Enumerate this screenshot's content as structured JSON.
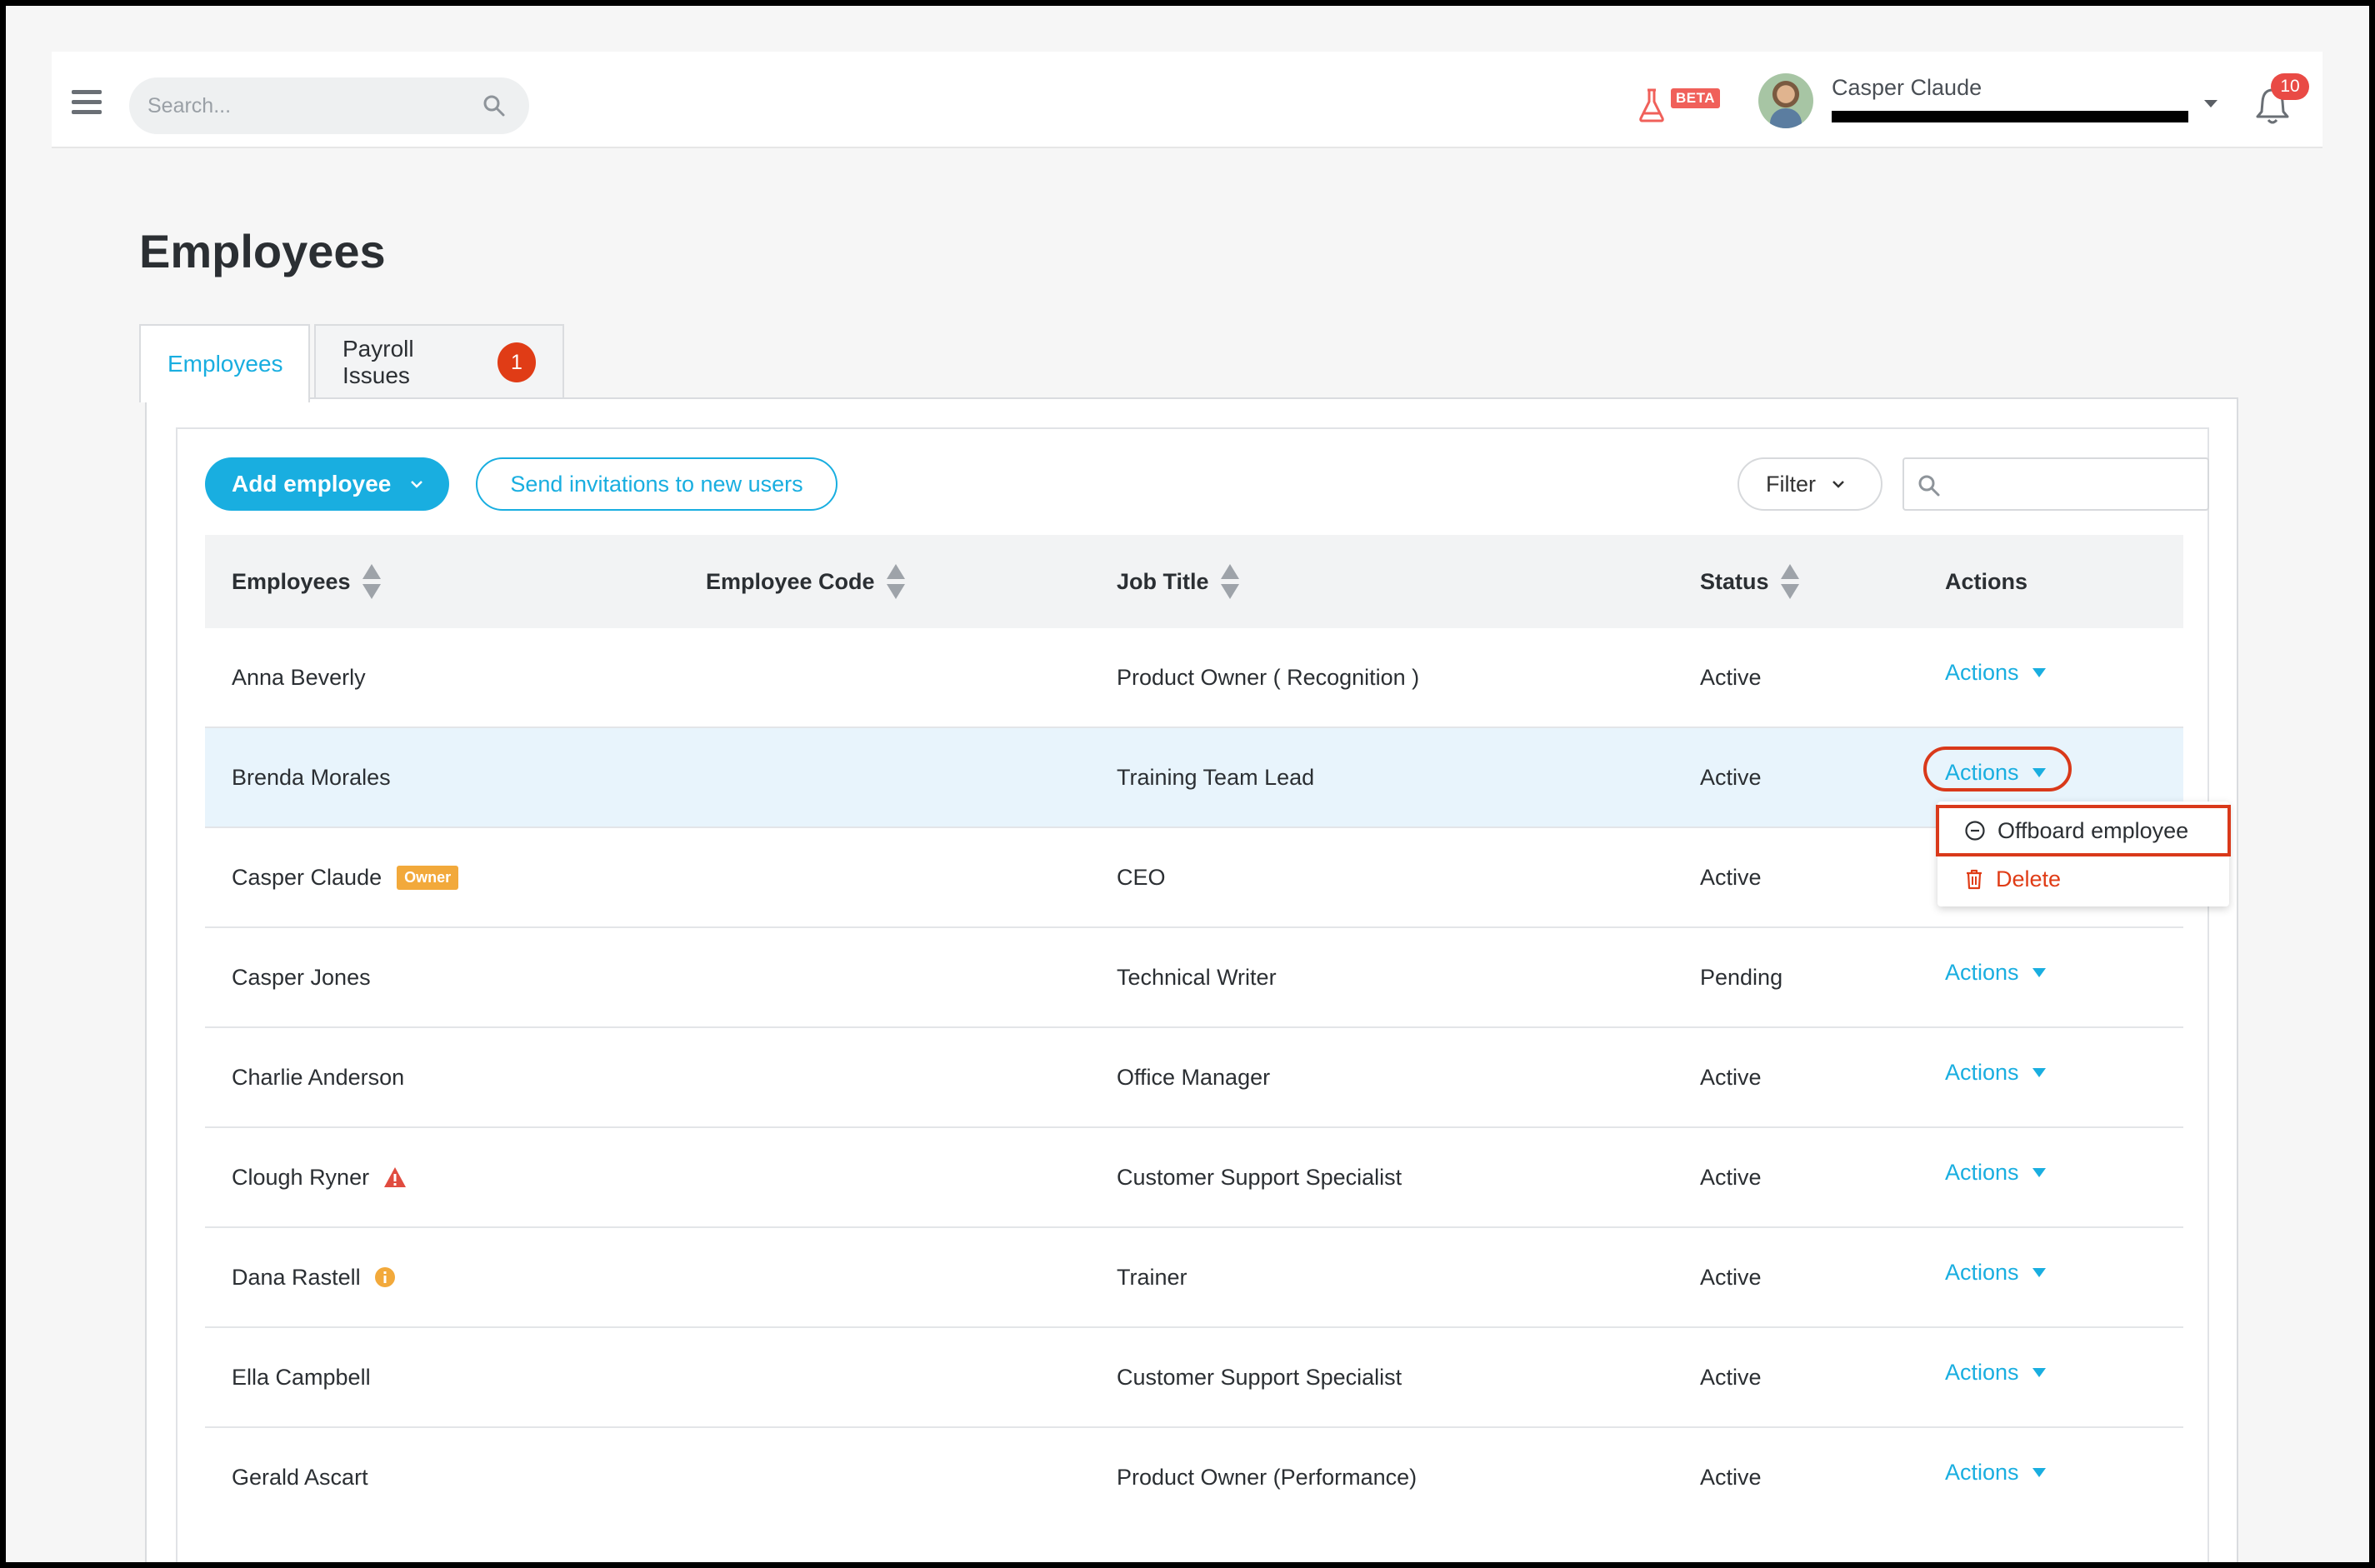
{
  "topbar": {
    "search_placeholder": "Search...",
    "beta_label": "BETA",
    "user_name": "Casper Claude",
    "notification_count": "10"
  },
  "page": {
    "title": "Employees"
  },
  "tabs": [
    {
      "label": "Employees",
      "active": true
    },
    {
      "label": "Payroll Issues",
      "count": "1"
    }
  ],
  "toolbar": {
    "add_employee": "Add employee",
    "send_invitations": "Send invitations to new users",
    "filter": "Filter",
    "search_value": ""
  },
  "table": {
    "headers": {
      "employees": "Employees",
      "employee_code": "Employee Code",
      "job_title": "Job Title",
      "status": "Status",
      "actions": "Actions"
    },
    "rows": [
      {
        "name": "Anna Beverly",
        "code": "",
        "title": "Product Owner ( Recognition )",
        "status": "Active",
        "action": "Actions"
      },
      {
        "name": "Brenda Morales",
        "code": "",
        "title": "Training Team Lead",
        "status": "Active",
        "action": "Actions"
      },
      {
        "name": "Casper Claude",
        "badge": "Owner",
        "code": "",
        "title": "CEO",
        "status": "Active",
        "action": "Actions"
      },
      {
        "name": "Casper Jones",
        "code": "",
        "title": "Technical Writer",
        "status": "Pending",
        "action": "Actions"
      },
      {
        "name": "Charlie Anderson",
        "code": "",
        "title": "Office Manager",
        "status": "Active",
        "action": "Actions"
      },
      {
        "name": "Clough Ryner",
        "icon": "warning-icon",
        "code": "",
        "title": "Customer Support Specialist",
        "status": "Active",
        "action": "Actions"
      },
      {
        "name": "Dana Rastell",
        "icon": "info-icon",
        "code": "",
        "title": "Trainer",
        "status": "Active",
        "action": "Actions"
      },
      {
        "name": "Ella Campbell",
        "code": "",
        "title": "Customer Support Specialist",
        "status": "Active",
        "action": "Actions"
      },
      {
        "name": "Gerald Ascart",
        "code": "",
        "title": "Product Owner (Performance)",
        "status": "Active",
        "action": "Actions"
      }
    ]
  },
  "actions_menu": {
    "offboard": "Offboard employee",
    "delete": "Delete"
  },
  "colors": {
    "accent": "#19aee0",
    "danger": "#e03c16",
    "owner_badge": "#f2a93b",
    "highlight_row": "#e8f4fc"
  }
}
